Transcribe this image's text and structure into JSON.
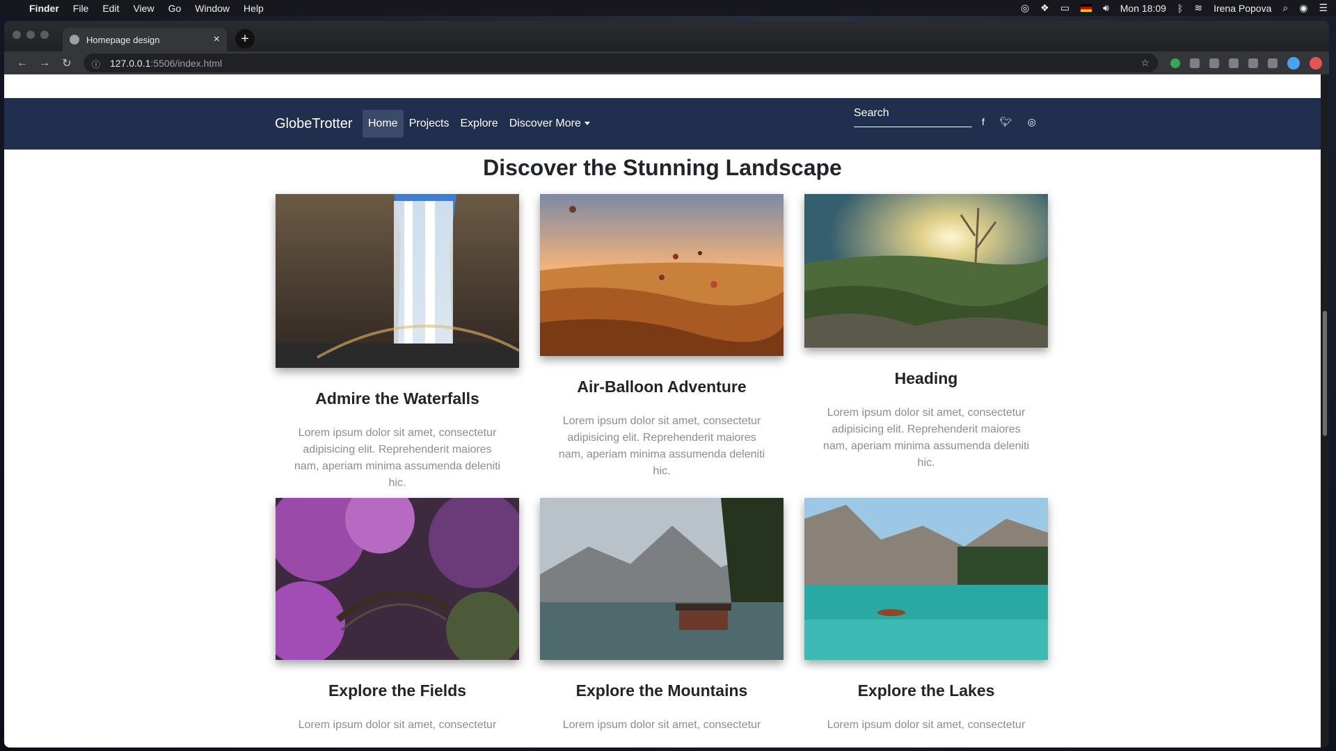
{
  "menubar": {
    "app": "Finder",
    "items": [
      "File",
      "Edit",
      "View",
      "Go",
      "Window",
      "Help"
    ],
    "clock": "Mon 18:09",
    "user": "Irena Popova"
  },
  "browser": {
    "tab_title": "Homepage design",
    "url_host": "127.0.0.1",
    "url_path": ":5506/index.html"
  },
  "site": {
    "brand": "GlobeTrotter",
    "nav": {
      "home": "Home",
      "projects": "Projects",
      "explore": "Explore",
      "discover": "Discover More"
    },
    "search_label": "Search",
    "title": "Discover the Stunning Landscape",
    "cards": [
      {
        "title": "Admire the Waterfalls",
        "text": "Lorem ipsum dolor sit amet, consectetur adipisicing elit. Reprehenderit maiores nam, aperiam minima assumenda deleniti hic."
      },
      {
        "title": "Air-Balloon Adventure",
        "text": "Lorem ipsum dolor sit amet, consectetur adipisicing elit. Reprehenderit maiores nam, aperiam minima assumenda deleniti hic."
      },
      {
        "title": "Heading",
        "text": "Lorem ipsum dolor sit amet, consectetur adipisicing elit. Reprehenderit maiores nam, aperiam minima assumenda deleniti hic."
      },
      {
        "title": "Explore the Fields",
        "text": "Lorem ipsum dolor sit amet, consectetur"
      },
      {
        "title": "Explore the Mountains",
        "text": "Lorem ipsum dolor sit amet, consectetur"
      },
      {
        "title": "Explore the Lakes",
        "text": "Lorem ipsum dolor sit amet, consectetur"
      }
    ]
  }
}
